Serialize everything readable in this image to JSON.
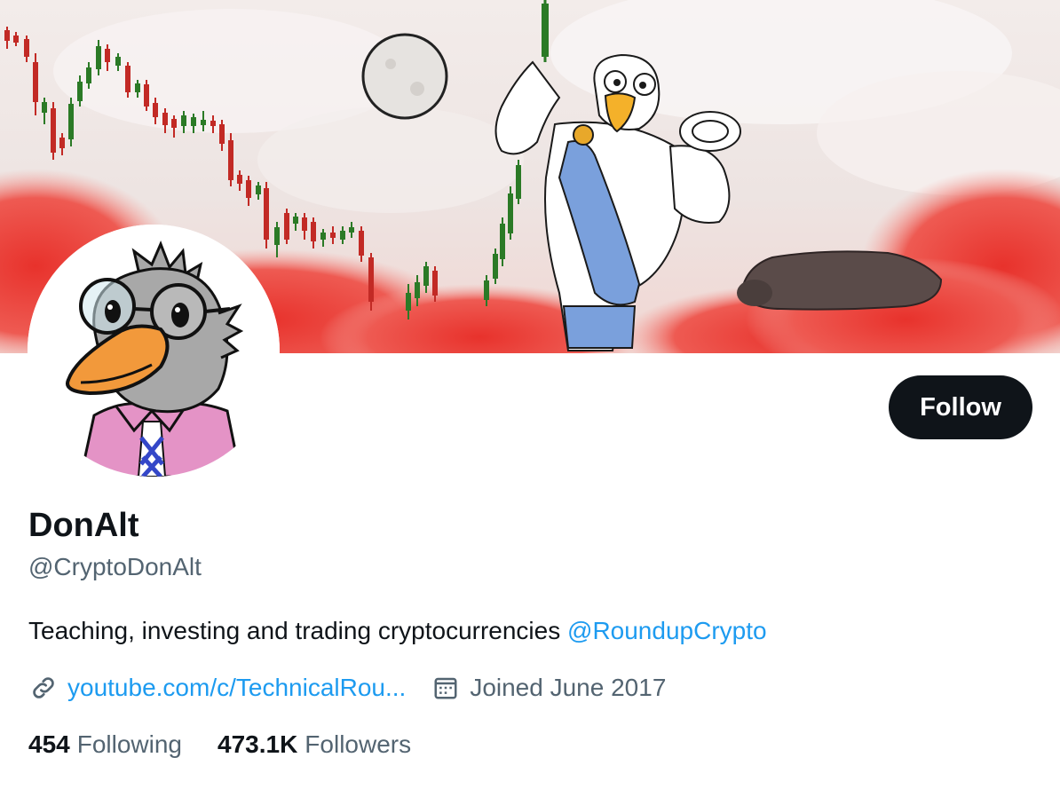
{
  "profile": {
    "display_name": "DonAlt",
    "handle": "@CryptoDonAlt",
    "bio_text": "Teaching, investing and trading cryptocurrencies ",
    "bio_mention": "@RoundupCrypto",
    "website": "youtube.com/c/TechnicalRou...",
    "joined": "Joined June 2017"
  },
  "actions": {
    "follow_label": "Follow"
  },
  "stats": {
    "following_count": "454",
    "following_label": "Following",
    "followers_count": "473.1K",
    "followers_label": "Followers"
  },
  "icons": {
    "website": "link-icon",
    "joined": "calendar-icon"
  },
  "colors": {
    "accent": "#1d9bf0",
    "text_primary": "#0f1419",
    "text_secondary": "#536471",
    "follow_button_bg": "#0f1419"
  }
}
